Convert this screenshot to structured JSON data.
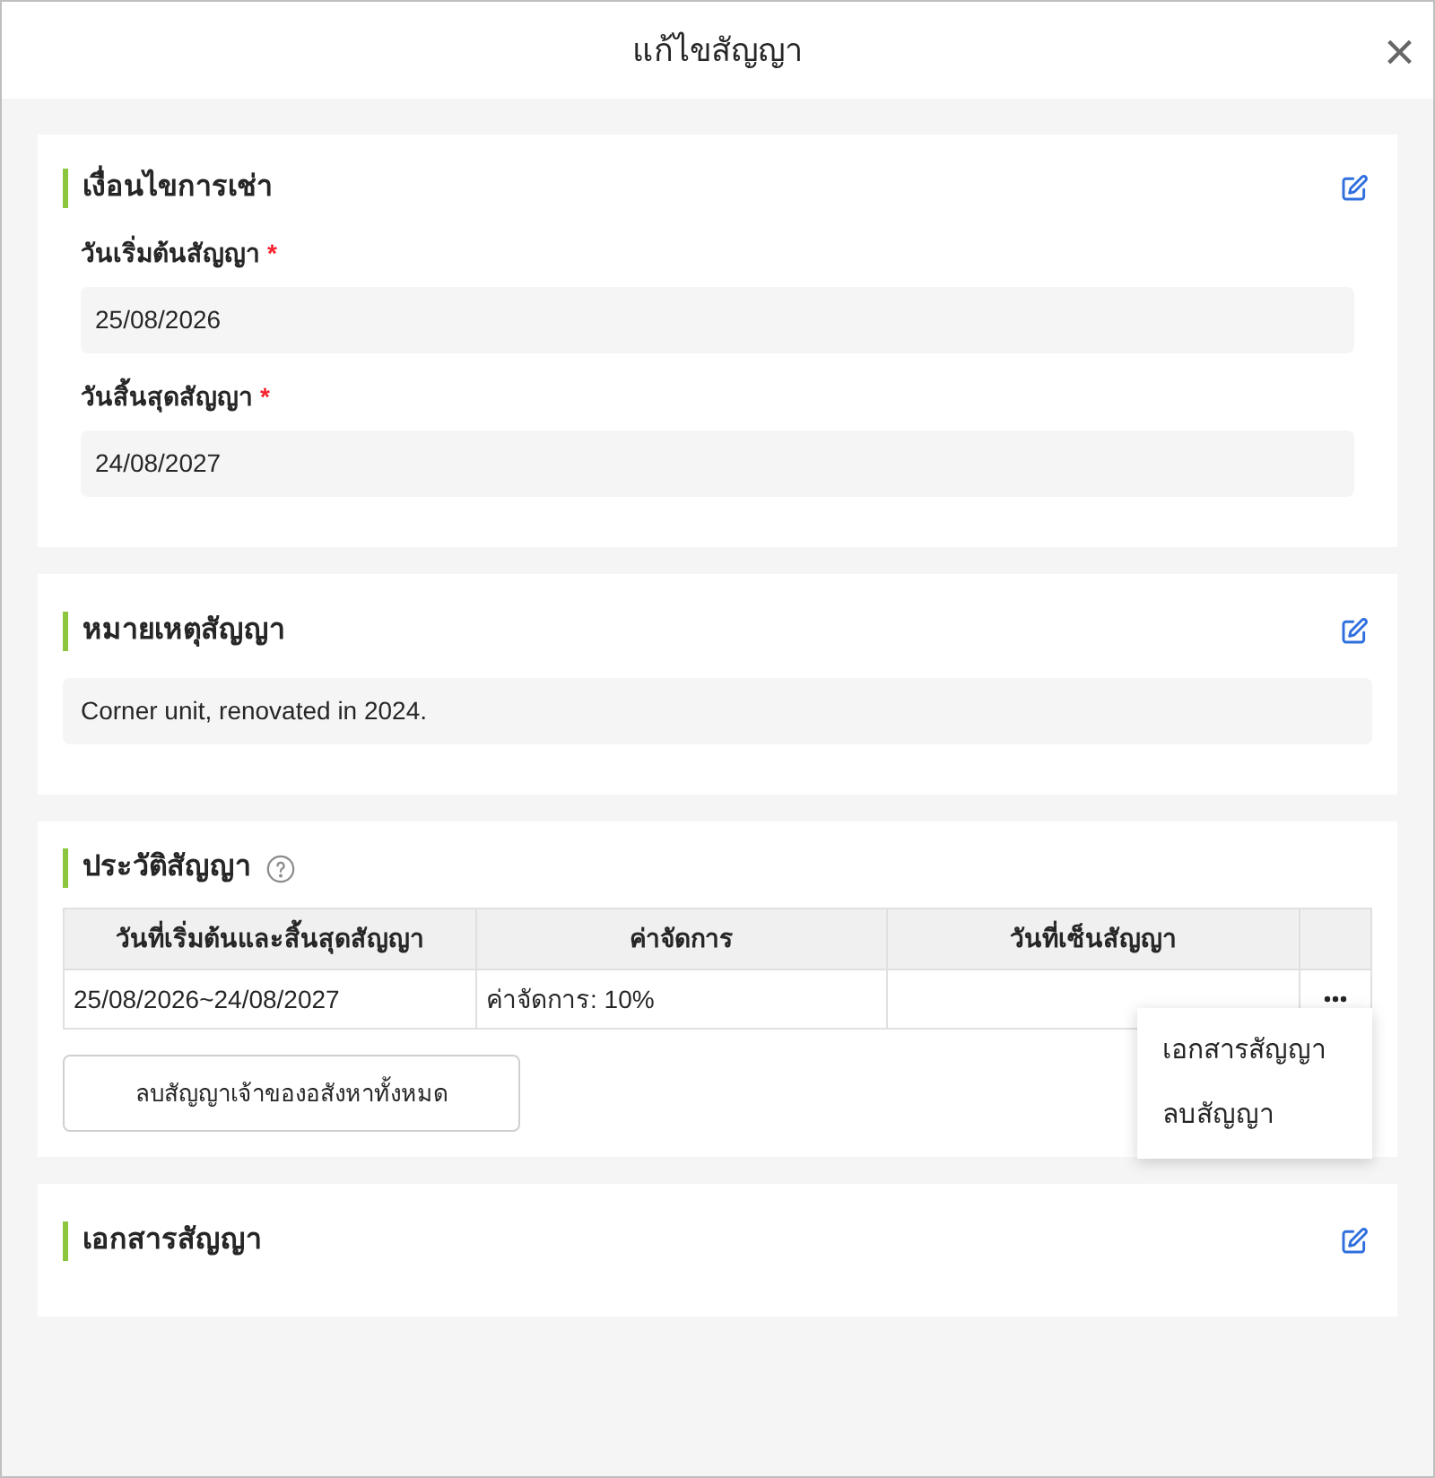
{
  "dialog": {
    "title": "แก้ไขสัญญา",
    "close": "×"
  },
  "lease_terms": {
    "title": "เงื่อนไขการเช่า",
    "fields": [
      {
        "label": "วันเริ่มต้นสัญญา",
        "required_mark": "*",
        "value": "25/08/2026"
      },
      {
        "label": "วันสิ้นสุดสัญญา",
        "required_mark": "*",
        "value": "24/08/2027"
      }
    ]
  },
  "notes": {
    "title": "หมายเหตุสัญญา",
    "value": "Corner unit, renovated in 2024."
  },
  "history": {
    "title": "ประวัติสัญญา",
    "table": {
      "columns": [
        "วันที่เริ่มต้นและสิ้นสุดสัญญา",
        "ค่าจัดการ",
        "วันที่เซ็นสัญญา"
      ],
      "rows": [
        {
          "cells": [
            "25/08/2026~24/08/2027",
            "ค่าจัดการ: 10%",
            ""
          ],
          "menu_open": true
        }
      ]
    },
    "menu": [
      "เอกสารสัญญา",
      "ลบสัญญา"
    ],
    "delete_all_button": "ลบสัญญาเจ้าของอสังหาทั้งหมด"
  },
  "documents": {
    "title": "เอกสารสัญญา"
  }
}
